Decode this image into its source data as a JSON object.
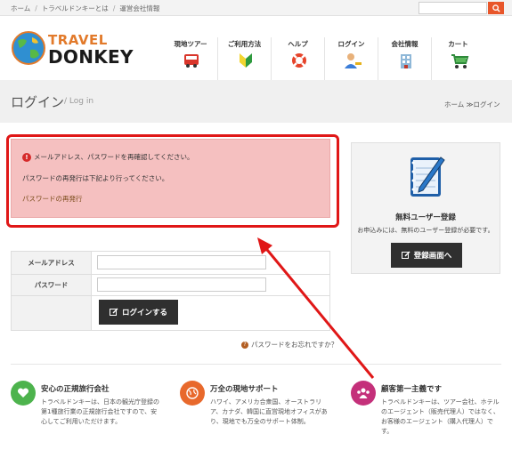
{
  "topbar": {
    "breadcrumbs": [
      "ホーム",
      "トラベルドンキーとは",
      "運営会社情報"
    ],
    "separator": "/",
    "search": {
      "value": "",
      "placeholder": ""
    }
  },
  "logo": {
    "line1": "TRAVEL",
    "line2": "DONKEY"
  },
  "nav": [
    {
      "label": "現地ツアー",
      "icon": "bus-icon"
    },
    {
      "label": "ご利用方法",
      "icon": "beginner-leaf-icon"
    },
    {
      "label": "ヘルプ",
      "icon": "lifebuoy-icon"
    },
    {
      "label": "ログイン",
      "icon": "user-key-icon"
    },
    {
      "label": "会社情報",
      "icon": "building-icon"
    },
    {
      "label": "カート",
      "icon": "cart-icon"
    }
  ],
  "page": {
    "title": "ログイン",
    "subtitle": "/ Log in",
    "breadcrumb_home": "ホーム",
    "breadcrumb_sep": "≫",
    "breadcrumb_current": "ログイン"
  },
  "alert": {
    "message": "メールアドレス、パスワードを再確認してください。",
    "reissue_note": "パスワードの再発行は下記より行ってください。",
    "reissue_link": "パスワードの再発行"
  },
  "form": {
    "email_label": "メールアドレス",
    "email_value": "",
    "password_label": "パスワード",
    "password_value": "",
    "login_button": "ログインする",
    "forgot_link": "パスワードをお忘れですか？"
  },
  "side": {
    "title": "無料ユーザー登録",
    "text": "お申込みには、無料のユーザー登録が必要です。",
    "register_button": "登録画面へ"
  },
  "features": [
    {
      "title": "安心の正規旅行会社",
      "text": "トラベルドンキーは、日本の観光庁登録の第1種旅行業の正規旅行会社ですので、安心してご利用いただけます。",
      "icon": "heart-icon",
      "color": "#4db34d"
    },
    {
      "title": "万全の現地サポート",
      "text": "ハワイ、アメリカ合衆国、オーストラリア、カナダ、韓国に直営現地オフィスがあり、現地でも万全のサポート体制。",
      "icon": "globe-icon",
      "color": "#e8692c"
    },
    {
      "title": "顧客第一主義です",
      "text": "トラベルドンキーは、ツアー会社、ホテルのエージェント（販売代理人）ではなく、お客様のエージェント（購入代理人）です。",
      "icon": "people-icon",
      "color": "#c4307a"
    }
  ],
  "colors": {
    "accent": "#e8562a",
    "alert_bg": "#f5c0c0",
    "highlight": "#e01717",
    "button": "#2f2f2f"
  }
}
